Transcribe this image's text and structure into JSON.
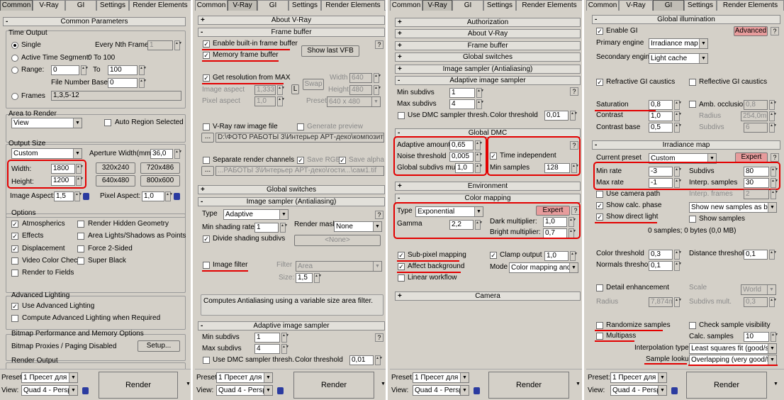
{
  "tabs": [
    "Common",
    "V-Ray",
    "GI",
    "Settings",
    "Render Elements"
  ],
  "p1": {
    "rollout": "Common Parameters",
    "time_output": {
      "title": "Time Output",
      "single": "Single",
      "every_nth": "Every Nth Frame:",
      "every_nth_val": "1",
      "active_segment": "Active Time Segment:",
      "active_segment_val": "0 To 100",
      "range": "Range:",
      "range_from": "0",
      "range_to_label": "To",
      "range_to": "100",
      "file_number_base": "File Number Base:",
      "file_number_base_val": "0",
      "frames": "Frames",
      "frames_val": "1,3,5-12"
    },
    "area": {
      "title": "Area to Render",
      "value": "View",
      "auto_region": "Auto Region Selected"
    },
    "output_size": {
      "title": "Output Size",
      "preset": "Custom",
      "aperture": "Aperture Width(mm):",
      "aperture_val": "36,0",
      "width": "Width:",
      "width_val": "1800",
      "height": "Height:",
      "height_val": "1200",
      "p1": "320x240",
      "p2": "720x486",
      "p3": "640x480",
      "p4": "800x600",
      "image_aspect": "Image Aspect:",
      "image_aspect_val": "1,5",
      "pixel_aspect": "Pixel Aspect:",
      "pixel_aspect_val": "1,0"
    },
    "options": {
      "title": "Options",
      "atmospherics": "Atmospherics",
      "render_hidden": "Render Hidden Geometry",
      "effects": "Effects",
      "area_lights": "Area Lights/Shadows as Points",
      "displacement": "Displacement",
      "force_2sided": "Force 2-Sided",
      "video_color": "Video Color Check",
      "super_black": "Super Black",
      "render_fields": "Render to Fields"
    },
    "adv_lighting": {
      "title": "Advanced Lighting",
      "use": "Use Advanced Lighting",
      "compute": "Compute Advanced Lighting when Required"
    },
    "bitmap": {
      "title": "Bitmap Performance and Memory Options",
      "proxies": "Bitmap Proxies / Paging Disabled",
      "setup": "Setup..."
    },
    "render_output": "Render Output"
  },
  "p2": {
    "about": "About V-Ray",
    "frame_buffer": "Frame buffer",
    "enable_builtin": "Enable built-in frame buffer",
    "memory_fb": "Memory frame buffer",
    "show_last_vfb": "Show last VFB",
    "get_res": "Get resolution from MAX",
    "width": "Width",
    "width_val": "640",
    "height": "Height",
    "height_val": "480",
    "image_aspect": "Image aspect",
    "image_aspect_val": "1,333",
    "l_btn": "L",
    "swap": "Swap",
    "pixel_aspect": "Pixel aspect",
    "pixel_aspect_val": "1,0",
    "preset": "Preset",
    "preset_val": "640 x 480",
    "raw_file": "V-Ray raw image file",
    "generate_preview": "Generate preview",
    "raw_path": "D:\\ФОТО РАБОТЫ 3\\Интерьер АРТ-деко\\композит\\1.exr",
    "separate_channels": "Separate render channels",
    "save_rgb": "Save RGB",
    "save_alpha": "Save alpha",
    "ch_path": "...РАБОТЫ 3\\Интерьер АРТ-деко\\гости...\\сам1.tif",
    "global_switches": "Global switches",
    "image_sampler": "Image sampler (Antialiasing)",
    "type": "Type",
    "type_val": "Adaptive",
    "min_shading": "Min shading rate",
    "min_shading_val": "1",
    "render_mask": "Render mask",
    "render_mask_val": "None",
    "divide_shading": "Divide shading subdivs",
    "none_btn": "<None>",
    "image_filter": "Image filter",
    "filter": "Filter",
    "filter_val": "Area",
    "size": "Size:",
    "size_val": "1,5",
    "filter_desc": "Computes Antialiasing using a variable size area filter.",
    "adaptive": "Adaptive image sampler",
    "min_subdivs": "Min subdivs",
    "min_subdivs_val": "1",
    "max_subdivs": "Max subdivs",
    "max_subdivs_val": "4",
    "use_dmc": "Use DMC sampler thresh.",
    "color_threshold": "Color threshold",
    "color_threshold_val": "0,01"
  },
  "p3": {
    "authorization": "Authorization",
    "about": "About V-Ray",
    "frame_buffer": "Frame buffer",
    "global_switches": "Global switches",
    "image_sampler": "Image sampler (Antialiasing)",
    "adaptive": "Adaptive image sampler",
    "min_subdivs": "Min subdivs",
    "min_subdivs_val": "1",
    "max_subdivs": "Max subdivs",
    "max_subdivs_val": "4",
    "use_dmc": "Use DMC sampler thresh.",
    "color_threshold": "Color threshold",
    "color_threshold_val": "0,01",
    "global_dmc": "Global DMC",
    "adaptive_amount": "Adaptive amount",
    "adaptive_amount_val": "0,65",
    "noise_threshold": "Noise threshold",
    "noise_threshold_val": "0,005",
    "global_subdivs": "Global subdivs mult.",
    "global_subdivs_val": "1,0",
    "time_independent": "Time independent",
    "min_samples": "Min samples",
    "min_samples_val": "128",
    "environment": "Environment",
    "color_mapping": "Color mapping",
    "type": "Type",
    "type_val": "Exponential",
    "expert": "Expert",
    "gamma": "Gamma",
    "gamma_val": "2,2",
    "dark_mult": "Dark multiplier:",
    "dark_mult_val": "1,0",
    "bright_mult": "Bright multiplier:",
    "bright_mult_val": "0,7",
    "subpixel": "Sub-pixel mapping",
    "clamp_output": "Clamp output",
    "clamp_val": "1,0",
    "affect_bg": "Affect background",
    "mode": "Mode",
    "mode_val": "Color mapping and g",
    "linear_workflow": "Linear workflow",
    "camera": "Camera"
  },
  "p4": {
    "global_illumination": "Global illumination",
    "enable_gi": "Enable GI",
    "advanced": "Advanced",
    "primary_engine": "Primary engine",
    "primary_val": "Irradiance map",
    "secondary_engine": "Secondary engine",
    "secondary_val": "Light cache",
    "refractive": "Refractive GI caustics",
    "reflective": "Reflective GI caustics",
    "saturation": "Saturation",
    "saturation_val": "0,8",
    "amb_occlusion": "Amb. occlusion",
    "amb_val": "0,8",
    "contrast": "Contrast",
    "contrast_val": "1,0",
    "radius": "Radius",
    "radius_val": "254,0m",
    "contrast_base": "Contrast base",
    "contrast_base_val": "0,5",
    "subdivs": "Subdivs",
    "subdivs_dis_val": "6",
    "irradiance_map": "Irradiance map",
    "current_preset": "Current preset",
    "preset_val": "Custom",
    "expert": "Expert",
    "min_rate": "Min rate",
    "min_rate_val": "-3",
    "subdivs_label": "Subdivs",
    "subdivs_val": "80",
    "max_rate": "Max rate",
    "max_rate_val": "-1",
    "interp_samples": "Interp. samples",
    "interp_samples_val": "30",
    "use_camera_path": "Use camera path",
    "interp_frames": "Interp. frames",
    "interp_frames_val": "2",
    "show_calc": "Show calc. phase",
    "show_new": "Show new samples as brigl",
    "show_direct": "Show direct light",
    "show_samples": "Show samples",
    "samples_info": "0 samples; 0 bytes (0,0 MB)",
    "color_threshold": "Color threshold",
    "color_threshold_val": "0,3",
    "distance_threshold": "Distance threshold",
    "distance_threshold_val": "0,1",
    "normals_threshold": "Normals threshold",
    "normals_threshold_val": "0,1",
    "detail_enh": "Detail enhancement",
    "scale": "Scale",
    "scale_val": "World",
    "radius_label": "Radius",
    "radius2_val": "7,874m",
    "subdivs_mult": "Subdivs mult.",
    "subdivs_mult_val": "0,3",
    "randomize": "Randomize samples",
    "check_vis": "Check sample visibility",
    "multipass": "Multipass",
    "calc_samples": "Calc. samples",
    "calc_samples_val": "10",
    "interp_type": "Interpolation type",
    "interp_type_val": "Least squares fit (good/sm",
    "sample_lookup": "Sample lookup",
    "sample_lookup_val": "Overlapping (very good/fa"
  },
  "bottom": {
    "preset": "Preset:",
    "preset_val": "1 Пресет для и",
    "view": "View:",
    "view_val": "Quad 4 - Perspe",
    "render": "Render"
  }
}
